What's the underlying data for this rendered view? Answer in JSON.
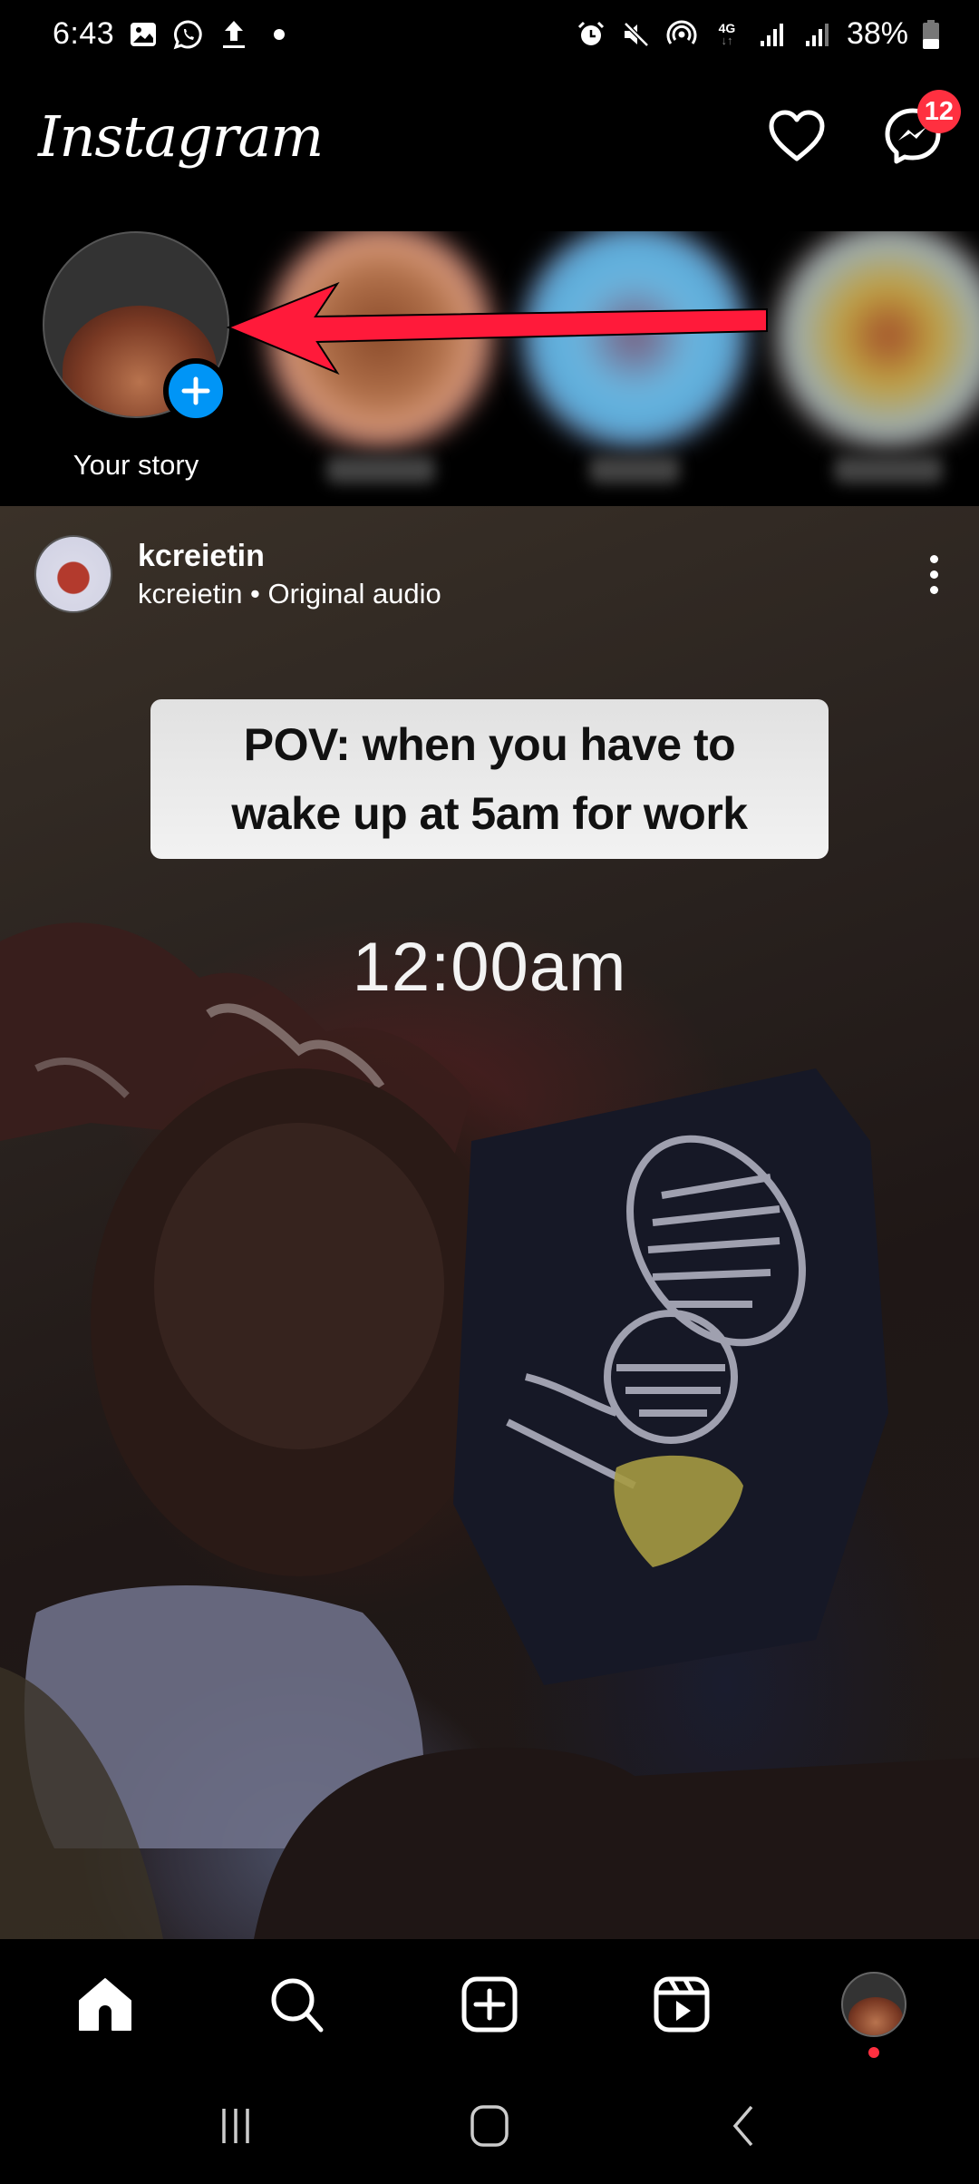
{
  "status_bar": {
    "time": "6:43",
    "left_icons": [
      "gallery-icon",
      "whatsapp-icon",
      "upload-icon",
      "dot-icon"
    ],
    "right_icons": [
      "alarm-icon",
      "mute-icon",
      "hotspot-icon",
      "4g-icon",
      "signal-icon",
      "signal-icon-2",
      "battery-icon"
    ],
    "network_label": "4G",
    "battery_percent": "38%"
  },
  "header": {
    "logo": "Instagram",
    "notifications_icon": "heart-icon",
    "messenger_icon": "messenger-icon",
    "messenger_badge": "12"
  },
  "stories": {
    "your_story_label": "Your story",
    "add_icon": "plus-icon",
    "blurred_count": 3
  },
  "annotation": {
    "arrow_color": "#ff1a3a",
    "arrow_direction": "left"
  },
  "post": {
    "username": "kcreietin",
    "subtitle": "kcreietin • Original audio",
    "more_icon": "more-vertical-icon",
    "caption_line1": "POV: when you have to",
    "caption_line2": "wake up at 5am for work",
    "time_overlay": "12:00am"
  },
  "bottom_nav": {
    "items": [
      {
        "name": "home",
        "icon": "home-icon",
        "active": true
      },
      {
        "name": "search",
        "icon": "search-icon"
      },
      {
        "name": "create",
        "icon": "add-post-icon"
      },
      {
        "name": "reels",
        "icon": "reels-icon"
      },
      {
        "name": "profile",
        "icon": "profile-avatar",
        "has_notification_dot": true
      }
    ]
  },
  "system_nav": {
    "items": [
      "recents",
      "home",
      "back"
    ]
  },
  "colors": {
    "badge": "#ff3040",
    "story_add": "#0095f6",
    "background": "#000000"
  }
}
